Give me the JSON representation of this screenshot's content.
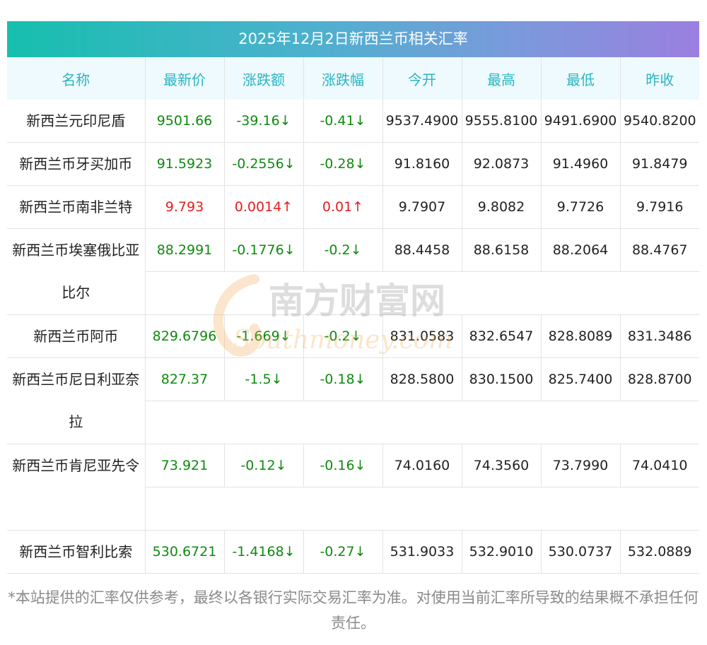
{
  "title": "2025年12月2日新西兰币相关汇率",
  "columns": [
    "名称",
    "最新价",
    "涨跌额",
    "涨跌幅",
    "今开",
    "最高",
    "最低",
    "昨收"
  ],
  "rows": [
    {
      "name": "新西兰元印尼盾",
      "latest": "9501.66",
      "change": "-39.16↓",
      "pct": "-0.41↓",
      "open": "9537.4900",
      "high": "9555.8100",
      "low": "9491.6900",
      "prev": "9540.8200",
      "dir": "down"
    },
    {
      "name": "新西兰币牙买加币",
      "latest": "91.5923",
      "change": "-0.2556↓",
      "pct": "-0.28↓",
      "open": "91.8160",
      "high": "92.0873",
      "low": "91.4960",
      "prev": "91.8479",
      "dir": "down"
    },
    {
      "name": "新西兰币南非兰特",
      "latest": "9.793",
      "change": "0.0014↑",
      "pct": "0.01↑",
      "open": "9.7907",
      "high": "9.8082",
      "low": "9.7726",
      "prev": "9.7916",
      "dir": "up"
    },
    {
      "name": "新西兰币埃塞俄比亚比尔",
      "latest": "88.2991",
      "change": "-0.1776↓",
      "pct": "-0.2↓",
      "open": "88.4458",
      "high": "88.6158",
      "low": "88.2064",
      "prev": "88.4767",
      "dir": "down"
    },
    {
      "name": "新西兰币阿币",
      "latest": "829.6796",
      "change": "-1.669↓",
      "pct": "-0.2↓",
      "open": "831.0583",
      "high": "832.6547",
      "low": "828.8089",
      "prev": "831.3486",
      "dir": "down"
    },
    {
      "name": "新西兰币尼日利亚奈拉",
      "latest": "827.37",
      "change": "-1.5↓",
      "pct": "-0.18↓",
      "open": "828.5800",
      "high": "830.1500",
      "low": "825.7400",
      "prev": "828.8700",
      "dir": "down"
    },
    {
      "name": "新西兰币肯尼亚先令",
      "latest": "73.921",
      "change": "-0.12↓",
      "pct": "-0.16↓",
      "open": "74.0160",
      "high": "74.3560",
      "low": "73.7990",
      "prev": "74.0410",
      "dir": "down"
    },
    {
      "name": "新西兰币智利比索",
      "latest": "530.6721",
      "change": "-1.4168↓",
      "pct": "-0.27↓",
      "open": "531.9033",
      "high": "532.9010",
      "low": "530.0737",
      "prev": "532.0889",
      "dir": "down"
    }
  ],
  "watermark": {
    "cn": "南方财富网",
    "en": "Southmoney.com"
  },
  "note": "*本站提供的汇率仅供参考，最终以各银行实际交易汇率为准。对使用当前汇率所导致的结果概不承担任何责任。",
  "colors": {
    "up": "#e61d1d",
    "down": "#0f8a0f",
    "header_text": "#2ab5c1",
    "title_start": "#16bfae",
    "title_end": "#9b7fe0"
  }
}
